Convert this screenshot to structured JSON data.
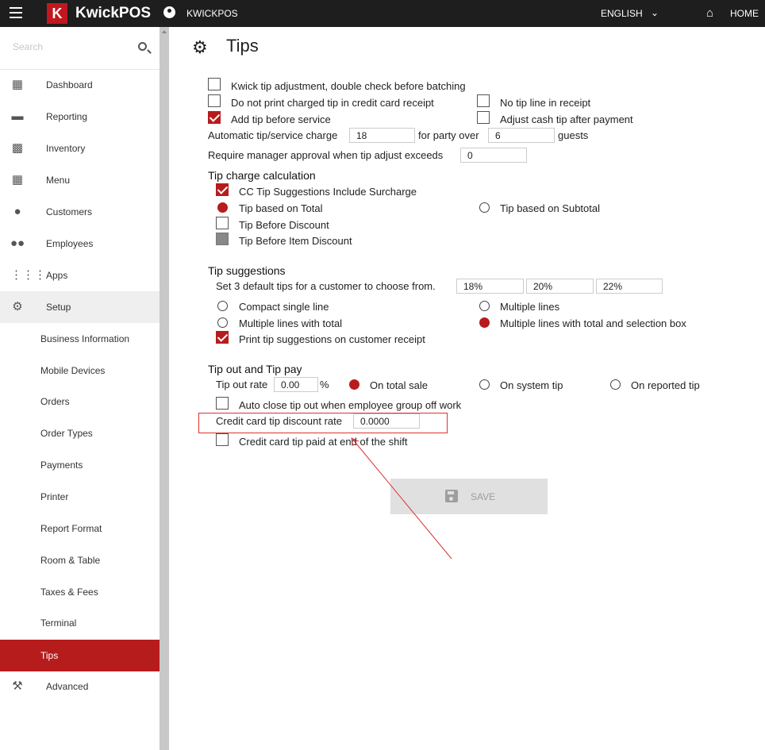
{
  "topbar": {
    "logo_letter": "K",
    "brand": "KwickPOS",
    "account": "KWICKPOS",
    "language": "ENGLISH",
    "home": "HOME"
  },
  "search": {
    "placeholder": "Search"
  },
  "sidebar": {
    "items": [
      {
        "label": "Dashboard",
        "icon": "dashboard-icon"
      },
      {
        "label": "Reporting",
        "icon": "reporting-icon"
      },
      {
        "label": "Inventory",
        "icon": "clipboard-icon"
      },
      {
        "label": "Menu",
        "icon": "grid-icon"
      },
      {
        "label": "Customers",
        "icon": "account-circle-icon"
      },
      {
        "label": "Employees",
        "icon": "people-icon"
      },
      {
        "label": "Apps",
        "icon": "apps-icon"
      },
      {
        "label": "Setup",
        "icon": "gear-icon"
      }
    ],
    "setup_sub": [
      "Business Information",
      "Mobile Devices",
      "Orders",
      "Order Types",
      "Payments",
      "Printer",
      "Report Format",
      "Room & Table",
      "Taxes & Fees",
      "Terminal",
      "Tips"
    ],
    "advanced": "Advanced",
    "active": "Tips"
  },
  "page": {
    "title": "Tips"
  },
  "options": {
    "kwick_adjust": {
      "label": "Kwick tip adjustment, double check before batching",
      "checked": false
    },
    "no_print_charged": {
      "label": "Do not print charged tip in credit card receipt",
      "checked": false
    },
    "no_tip_line": {
      "label": "No tip line in receipt",
      "checked": false
    },
    "add_before_service": {
      "label": "Add tip before service",
      "checked": true
    },
    "adjust_cash": {
      "label": "Adjust cash tip after payment",
      "checked": false
    },
    "auto_charge_label": "Automatic tip/service charge",
    "auto_charge_value": "18",
    "party_over_label": "for party over",
    "party_over_value": "6",
    "guests_label": "guests",
    "manager_label": "Require manager approval when tip adjust exceeds",
    "manager_value": "0"
  },
  "calc": {
    "heading": "Tip charge calculation",
    "cc_surcharge": {
      "label": "CC Tip Suggestions Include Surcharge",
      "checked": true
    },
    "on_total": {
      "label": "Tip based on Total",
      "selected": true
    },
    "on_subtotal": {
      "label": "Tip based on Subtotal",
      "selected": false
    },
    "before_discount": {
      "label": "Tip Before Discount",
      "checked": false
    },
    "before_item_discount": {
      "label": "Tip Before Item Discount",
      "checked": false
    }
  },
  "suggestions": {
    "heading": "Tip suggestions",
    "default_label": "Set 3 default tips for a customer to choose from.",
    "defaults": [
      "18%",
      "20%",
      "22%"
    ],
    "compact": {
      "label": "Compact single line",
      "selected": false
    },
    "multiple": {
      "label": "Multiple lines",
      "selected": false
    },
    "multiple_total": {
      "label": "Multiple lines with total",
      "selected": false
    },
    "multiple_total_box": {
      "label": "Multiple lines with total and selection box",
      "selected": true
    },
    "print_on_receipt": {
      "label": "Print tip suggestions on customer receipt",
      "checked": true
    }
  },
  "tipout": {
    "heading": "Tip out and Tip pay",
    "rate_label": "Tip out rate",
    "rate_value": "0.00",
    "percent": "%",
    "total_sale": {
      "label": "On total sale",
      "selected": true
    },
    "system_tip": {
      "label": "On system tip",
      "selected": false
    },
    "reported_tip": {
      "label": "On reported tip",
      "selected": false
    },
    "auto_close": {
      "label": "Auto close tip out when employee group off work",
      "checked": false
    },
    "cc_discount_label": "Credit card tip discount rate",
    "cc_discount_value": "0.0000",
    "cc_paid_end": {
      "label": "Credit card tip paid at end of the shift",
      "checked": false
    }
  },
  "save_label": "SAVE",
  "colors": {
    "accent": "#b71c1c",
    "topbar": "#1e1e1e",
    "annotation": "#e03131"
  }
}
